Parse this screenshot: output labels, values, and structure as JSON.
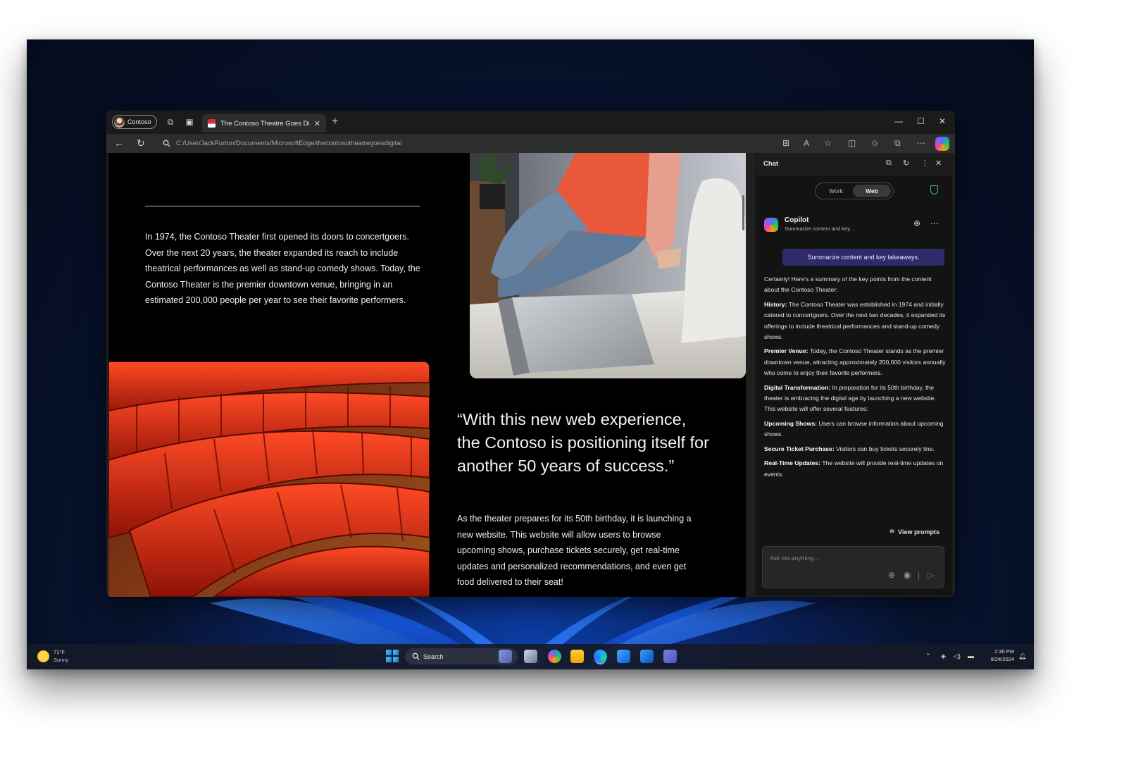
{
  "browser": {
    "profile_label": "Contoso",
    "tab_title": "The Contoso Theatre Goes Digi...",
    "url": "C:/User/JackPurton/Documents/MicrosoftEdge/thecontosotheatregoesdigital"
  },
  "page": {
    "intro": "In 1974, the Contoso Theater first opened its doors to concertgoers. Over the next 20 years, the theater expanded its reach to include theatrical performances as well as stand-up comedy shows. Today, the Contoso Theater is the premier downtown venue, bringing in an estimated 200,000 people per year to see their favorite performers.",
    "quote": "“With this new web experience, the Contoso is positioning itself for another 50 years of success.”",
    "body": "As the theater prepares for its 50th birthday, it is launching a new website. This website will allow users to browse upcoming shows, purchase tickets securely, get real-time updates and personalized recommendations, and even get food delivered to their seat!"
  },
  "chat": {
    "title": "Chat",
    "toggle_work": "Work",
    "toggle_web": "Web",
    "bot_name": "Copilot",
    "bot_subtitle": "Summarize content and key...",
    "user_message": "Summarize content and key takeaways.",
    "response_intro": "Certainly! Here's a summary of the key points from the content about the Contoso Theater:",
    "points": [
      {
        "label": "History:",
        "text": "The Contoso Theater was established in 1974 and initially catered to concertgoers. Over the next two decades, it expanded its offerings to include theatrical performances and stand-up comedy shows."
      },
      {
        "label": "Premier Venue:",
        "text": "Today, the Contoso Theater stands as the premier downtown venue, attracting approximately 200,000 visitors annually who come to enjoy their favorite performers."
      },
      {
        "label": "Digital Transformation:",
        "text": "In preparation for its 50th birthday, the theater is embracing the digital age by launching a new website. This website will offer several features:"
      },
      {
        "label": "Upcoming Shows:",
        "text": "Users can browse information about upcoming shows."
      },
      {
        "label": "Secure Ticket Purchase:",
        "text": "Visitors can buy tickets securely line."
      },
      {
        "label": "Real-Time Updates:",
        "text": "The website will provide real-time updates on events."
      }
    ],
    "view_prompts": "View prompts",
    "input_placeholder": "Ask me anything..."
  },
  "taskbar": {
    "temperature": "71°F",
    "condition": "Sunny",
    "search_label": "Search",
    "time": "2:30 PM",
    "date": "9/24/2024"
  },
  "colors": {
    "accent": "#2f2a6b",
    "copilot_gradient": [
      "#3b82f6",
      "#22c55e",
      "#f59e0b",
      "#ec4899",
      "#8b5cf6"
    ],
    "seat_red": "#d42a12"
  }
}
